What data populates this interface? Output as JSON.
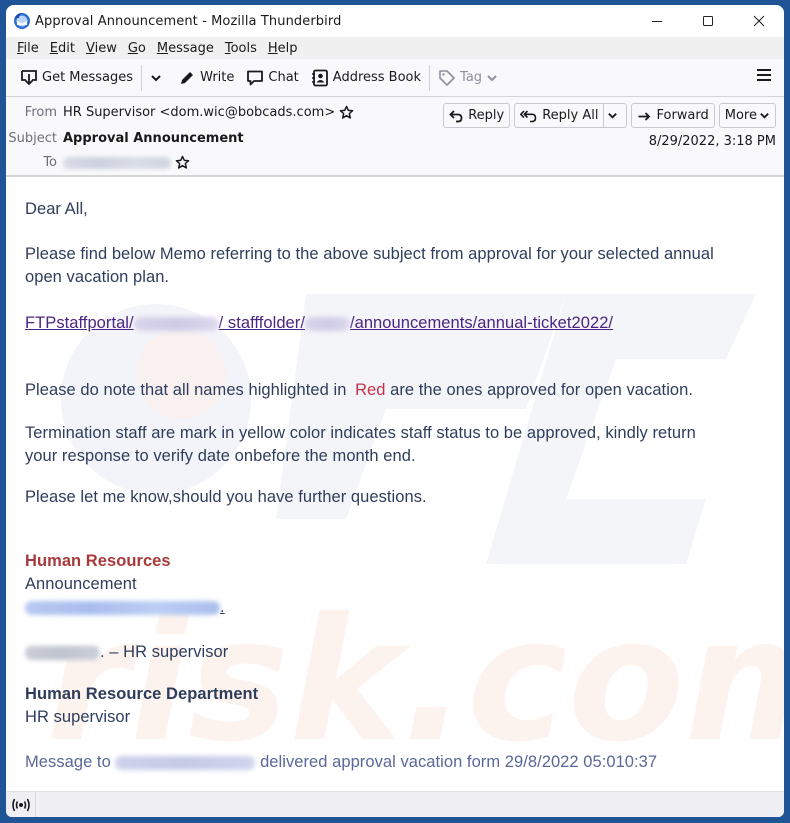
{
  "window": {
    "title": "Approval Announcement - Mozilla Thunderbird",
    "app_icon": "thunderbird-logo-icon",
    "controls": [
      "minimize-icon",
      "maximize-icon",
      "close-icon"
    ]
  },
  "menubar": {
    "items": [
      {
        "accel": "F",
        "rest": "ile"
      },
      {
        "accel": "E",
        "rest": "dit"
      },
      {
        "accel": "V",
        "rest": "iew"
      },
      {
        "accel": "G",
        "rest": "o"
      },
      {
        "accel": "M",
        "rest": "essage"
      },
      {
        "accel": "T",
        "rest": "ools"
      },
      {
        "accel": "H",
        "rest": "elp"
      }
    ]
  },
  "toolbar": {
    "get_messages": "Get Messages",
    "write": "Write",
    "chat": "Chat",
    "address_book": "Address Book",
    "tag": "Tag",
    "menu_icon": "hamburger-menu-icon"
  },
  "header": {
    "from_label": "From",
    "from_value": "HR Supervisor <dom.wic@bobcads.com>",
    "subject_label": "Subject",
    "subject_value": "Approval Announcement",
    "to_label": "To",
    "to_value_redacted": true,
    "date": "8/29/2022, 3:18 PM",
    "buttons": {
      "reply": "Reply",
      "reply_all": "Reply All",
      "forward": "Forward",
      "more": "More"
    }
  },
  "body": {
    "greeting": "Dear All,",
    "para1_line1": "Please find below Memo referring to the above subject from approval for your selected annual",
    "para1_line2": "open vacation plan.",
    "link": {
      "part1": "FTPstaffportal/",
      "part2": "/ stafffolder/",
      "part3": "/announcements/annual-ticket2022/"
    },
    "para2_before": "Please do note that all names highlighted in ",
    "para2_red": "Red",
    "para2_after": " are the ones approved for open vacation.",
    "para3_line1": "Termination staff are mark in yellow color indicates staff status to be approved, kindly return",
    "para3_line2": "your response to verify date onbefore the month end.",
    "para4": "Please let me know,should you have further questions.",
    "sig_title": "Human Resources",
    "sig_line2": "Announcement",
    "sig_email_suffix": ".",
    "sig_domain_suffix": ". – HR supervisor",
    "dept_title": "Human Resource Department",
    "dept_line2": "HR supervisor",
    "footer_before": "Message to ",
    "footer_after": " delivered approval vacation form 29/8/2022 05:010:37"
  },
  "statusbar": {
    "icon": "online-status-icon"
  },
  "colors": {
    "desktop": "#1f5597",
    "link": "#4b2582",
    "red_text": "#c8334b",
    "signature_red": "#a83a3c",
    "body_text": "#2f3d5c"
  }
}
